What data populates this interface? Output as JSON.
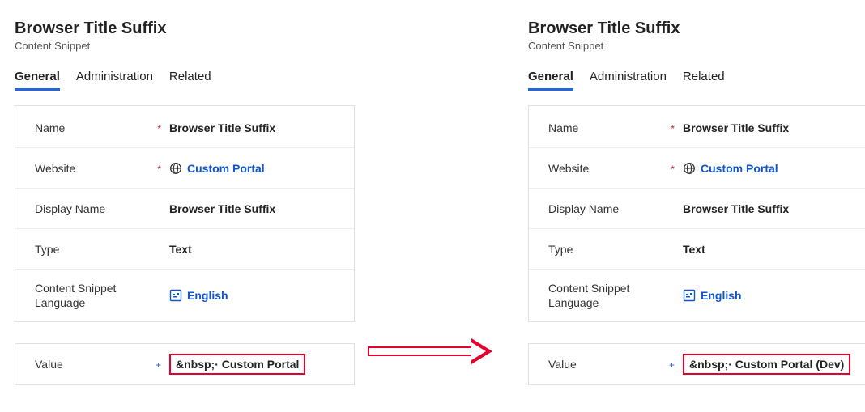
{
  "left": {
    "title": "Browser Title Suffix",
    "subtitle": "Content Snippet",
    "tabs": {
      "general": "General",
      "admin": "Administration",
      "related": "Related"
    },
    "fields": {
      "name_label": "Name",
      "name_value": "Browser Title Suffix",
      "website_label": "Website",
      "website_value": "Custom Portal",
      "display_label": "Display Name",
      "display_value": "Browser Title Suffix",
      "type_label": "Type",
      "type_value": "Text",
      "lang_label": "Content Snippet Language",
      "lang_value": "English",
      "value_label": "Value",
      "value_value": "&nbsp;· Custom Portal"
    }
  },
  "right": {
    "title": "Browser Title Suffix",
    "subtitle": "Content Snippet",
    "tabs": {
      "general": "General",
      "admin": "Administration",
      "related": "Related"
    },
    "fields": {
      "name_label": "Name",
      "name_value": "Browser Title Suffix",
      "website_label": "Website",
      "website_value": "Custom Portal",
      "display_label": "Display Name",
      "display_value": "Browser Title Suffix",
      "type_label": "Type",
      "type_value": "Text",
      "lang_label": "Content Snippet Language",
      "lang_value": "English",
      "value_label": "Value",
      "value_value": "&nbsp;· Custom Portal (Dev)"
    }
  },
  "marks": {
    "required": "*",
    "plus": "+"
  }
}
